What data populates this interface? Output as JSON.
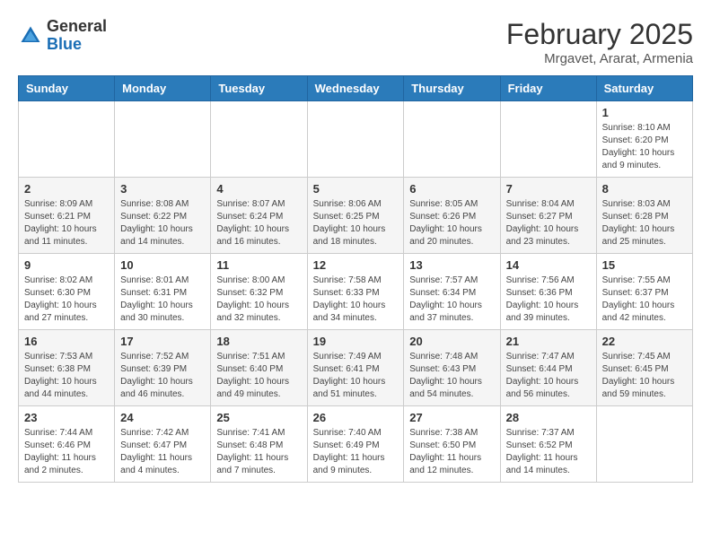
{
  "header": {
    "logo_line1": "General",
    "logo_line2": "Blue",
    "month_year": "February 2025",
    "location": "Mrgavet, Ararat, Armenia"
  },
  "days_of_week": [
    "Sunday",
    "Monday",
    "Tuesday",
    "Wednesday",
    "Thursday",
    "Friday",
    "Saturday"
  ],
  "weeks": [
    [
      {
        "day": "",
        "info": ""
      },
      {
        "day": "",
        "info": ""
      },
      {
        "day": "",
        "info": ""
      },
      {
        "day": "",
        "info": ""
      },
      {
        "day": "",
        "info": ""
      },
      {
        "day": "",
        "info": ""
      },
      {
        "day": "1",
        "info": "Sunrise: 8:10 AM\nSunset: 6:20 PM\nDaylight: 10 hours\nand 9 minutes."
      }
    ],
    [
      {
        "day": "2",
        "info": "Sunrise: 8:09 AM\nSunset: 6:21 PM\nDaylight: 10 hours\nand 11 minutes."
      },
      {
        "day": "3",
        "info": "Sunrise: 8:08 AM\nSunset: 6:22 PM\nDaylight: 10 hours\nand 14 minutes."
      },
      {
        "day": "4",
        "info": "Sunrise: 8:07 AM\nSunset: 6:24 PM\nDaylight: 10 hours\nand 16 minutes."
      },
      {
        "day": "5",
        "info": "Sunrise: 8:06 AM\nSunset: 6:25 PM\nDaylight: 10 hours\nand 18 minutes."
      },
      {
        "day": "6",
        "info": "Sunrise: 8:05 AM\nSunset: 6:26 PM\nDaylight: 10 hours\nand 20 minutes."
      },
      {
        "day": "7",
        "info": "Sunrise: 8:04 AM\nSunset: 6:27 PM\nDaylight: 10 hours\nand 23 minutes."
      },
      {
        "day": "8",
        "info": "Sunrise: 8:03 AM\nSunset: 6:28 PM\nDaylight: 10 hours\nand 25 minutes."
      }
    ],
    [
      {
        "day": "9",
        "info": "Sunrise: 8:02 AM\nSunset: 6:30 PM\nDaylight: 10 hours\nand 27 minutes."
      },
      {
        "day": "10",
        "info": "Sunrise: 8:01 AM\nSunset: 6:31 PM\nDaylight: 10 hours\nand 30 minutes."
      },
      {
        "day": "11",
        "info": "Sunrise: 8:00 AM\nSunset: 6:32 PM\nDaylight: 10 hours\nand 32 minutes."
      },
      {
        "day": "12",
        "info": "Sunrise: 7:58 AM\nSunset: 6:33 PM\nDaylight: 10 hours\nand 34 minutes."
      },
      {
        "day": "13",
        "info": "Sunrise: 7:57 AM\nSunset: 6:34 PM\nDaylight: 10 hours\nand 37 minutes."
      },
      {
        "day": "14",
        "info": "Sunrise: 7:56 AM\nSunset: 6:36 PM\nDaylight: 10 hours\nand 39 minutes."
      },
      {
        "day": "15",
        "info": "Sunrise: 7:55 AM\nSunset: 6:37 PM\nDaylight: 10 hours\nand 42 minutes."
      }
    ],
    [
      {
        "day": "16",
        "info": "Sunrise: 7:53 AM\nSunset: 6:38 PM\nDaylight: 10 hours\nand 44 minutes."
      },
      {
        "day": "17",
        "info": "Sunrise: 7:52 AM\nSunset: 6:39 PM\nDaylight: 10 hours\nand 46 minutes."
      },
      {
        "day": "18",
        "info": "Sunrise: 7:51 AM\nSunset: 6:40 PM\nDaylight: 10 hours\nand 49 minutes."
      },
      {
        "day": "19",
        "info": "Sunrise: 7:49 AM\nSunset: 6:41 PM\nDaylight: 10 hours\nand 51 minutes."
      },
      {
        "day": "20",
        "info": "Sunrise: 7:48 AM\nSunset: 6:43 PM\nDaylight: 10 hours\nand 54 minutes."
      },
      {
        "day": "21",
        "info": "Sunrise: 7:47 AM\nSunset: 6:44 PM\nDaylight: 10 hours\nand 56 minutes."
      },
      {
        "day": "22",
        "info": "Sunrise: 7:45 AM\nSunset: 6:45 PM\nDaylight: 10 hours\nand 59 minutes."
      }
    ],
    [
      {
        "day": "23",
        "info": "Sunrise: 7:44 AM\nSunset: 6:46 PM\nDaylight: 11 hours\nand 2 minutes."
      },
      {
        "day": "24",
        "info": "Sunrise: 7:42 AM\nSunset: 6:47 PM\nDaylight: 11 hours\nand 4 minutes."
      },
      {
        "day": "25",
        "info": "Sunrise: 7:41 AM\nSunset: 6:48 PM\nDaylight: 11 hours\nand 7 minutes."
      },
      {
        "day": "26",
        "info": "Sunrise: 7:40 AM\nSunset: 6:49 PM\nDaylight: 11 hours\nand 9 minutes."
      },
      {
        "day": "27",
        "info": "Sunrise: 7:38 AM\nSunset: 6:50 PM\nDaylight: 11 hours\nand 12 minutes."
      },
      {
        "day": "28",
        "info": "Sunrise: 7:37 AM\nSunset: 6:52 PM\nDaylight: 11 hours\nand 14 minutes."
      },
      {
        "day": "",
        "info": ""
      }
    ]
  ]
}
